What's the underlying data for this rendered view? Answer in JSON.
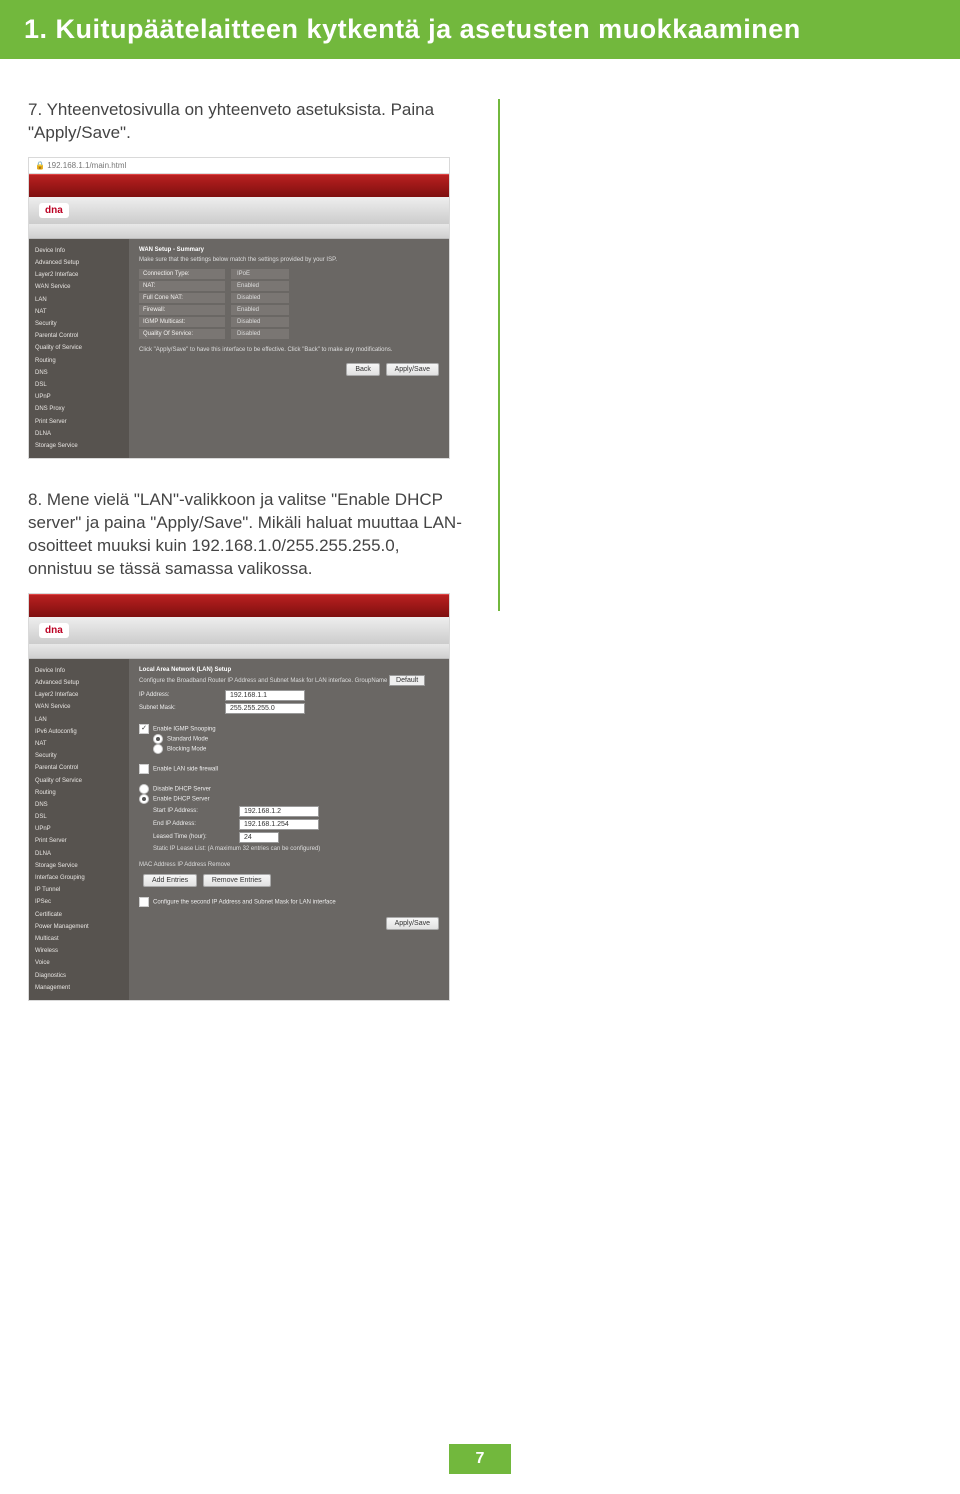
{
  "header": {
    "title": "1. Kuitupäätelaitteen kytkentä ja asetusten muokkaaminen"
  },
  "step7": {
    "text": "7. Yhteenvetosivulla on yhteenveto asetuksista. Paina \"Apply/Save\"."
  },
  "step8": {
    "text": "8. Mene vielä \"LAN\"-valikkoon ja valitse \"Enable DHCP server\" ja paina \"Apply/Save\". Mikäli haluat muuttaa LAN-osoitteet muuksi kuin 192.168.1.0/255.255.255.0, onnistuu se tässä samassa valikossa."
  },
  "shot1": {
    "url": "192.168.1.1/main.html",
    "logo": "dna",
    "sidebar": [
      "Device Info",
      "Advanced Setup",
      "Layer2 Interface",
      "WAN Service",
      "LAN",
      "NAT",
      "Security",
      "Parental Control",
      "Quality of Service",
      "Routing",
      "DNS",
      "DSL",
      "UPnP",
      "DNS Proxy",
      "Print Server",
      "DLNA",
      "Storage Service"
    ],
    "heading": "WAN Setup - Summary",
    "note": "Make sure that the settings below match the settings provided by your ISP.",
    "rows": [
      {
        "k": "Connection Type:",
        "v": "IPoE"
      },
      {
        "k": "NAT:",
        "v": "Enabled"
      },
      {
        "k": "Full Cone NAT:",
        "v": "Disabled"
      },
      {
        "k": "Firewall:",
        "v": "Enabled"
      },
      {
        "k": "IGMP Multicast:",
        "v": "Disabled"
      },
      {
        "k": "Quality Of Service:",
        "v": "Disabled"
      }
    ],
    "foot": "Click \"Apply/Save\" to have this interface to be effective. Click \"Back\" to make any modifications.",
    "btn_back": "Back",
    "btn_apply": "Apply/Save"
  },
  "shot2": {
    "logo": "dna",
    "sidebar": [
      "Device Info",
      "Advanced Setup",
      "Layer2 Interface",
      "WAN Service",
      "LAN",
      "IPv6 Autoconfig",
      "NAT",
      "Security",
      "Parental Control",
      "Quality of Service",
      "Routing",
      "DNS",
      "DSL",
      "UPnP",
      "Print Server",
      "DLNA",
      "Storage Service",
      "Interface Grouping",
      "IP Tunnel",
      "IPSec",
      "Certificate",
      "Power Management",
      "Multicast",
      "Wireless",
      "Voice",
      "Diagnostics",
      "Management"
    ],
    "heading": "Local Area Network (LAN) Setup",
    "note": "Configure the Broadband Router IP Address and Subnet Mask for LAN interface. GroupName",
    "group_default": "Default",
    "ip_label": "IP Address:",
    "ip_value": "192.168.1.1",
    "mask_label": "Subnet Mask:",
    "mask_value": "255.255.255.0",
    "igmp": "Enable IGMP Snooping",
    "mode_std": "Standard Mode",
    "mode_block": "Blocking Mode",
    "lanfw": "Enable LAN side firewall",
    "dhcp_off": "Disable DHCP Server",
    "dhcp_on": "Enable DHCP Server",
    "start_label": "Start IP Address:",
    "start_value": "192.168.1.2",
    "end_label": "End IP Address:",
    "end_value": "192.168.1.254",
    "lease_label": "Leased Time (hour):",
    "lease_value": "24",
    "static_note": "Static IP Lease List: (A maximum 32 entries can be configured)",
    "cols": "MAC Address   IP Address   Remove",
    "btn_add": "Add Entries",
    "btn_remove": "Remove Entries",
    "second_ip": "Configure the second IP Address and Subnet Mask for LAN interface",
    "btn_apply": "Apply/Save"
  },
  "page_number": "7"
}
